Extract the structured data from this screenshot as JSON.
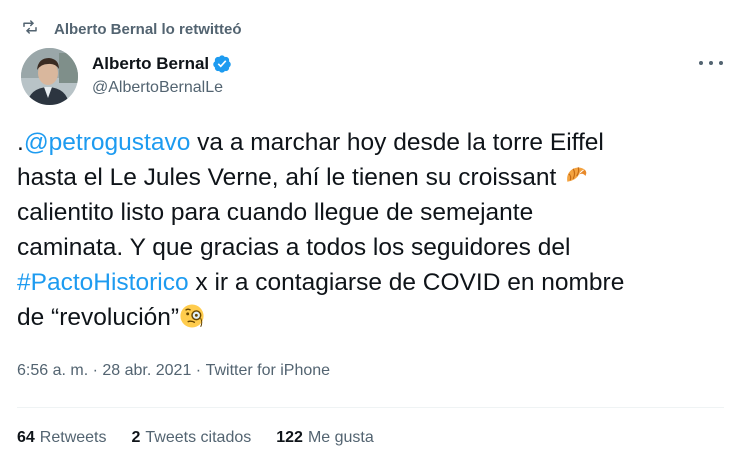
{
  "retweet": {
    "text": "Alberto Bernal lo retwitteó"
  },
  "author": {
    "name": "Alberto Bernal",
    "handle": "@AlbertoBernalLe"
  },
  "tweet": {
    "lines": [
      [
        {
          "t": "."
        },
        {
          "t": "@petrogustavo",
          "link": true
        },
        {
          "t": " va a marchar hoy desde la torre Eiffel"
        }
      ],
      [
        {
          "t": "hasta el Le Jules Verne, ahí le tienen su croissant "
        },
        {
          "emoji": "croissant"
        }
      ],
      [
        {
          "t": "calientito listo para cuando llegue de semejante"
        }
      ],
      [
        {
          "t": "caminata. Y que gracias a todos los seguidores del"
        }
      ],
      [
        {
          "t": "#PactoHistorico",
          "link": true
        },
        {
          "t": " x ir a contagiarse de COVID en nombre"
        }
      ],
      [
        {
          "t": "de “revolución”"
        },
        {
          "emoji": "monocle"
        }
      ]
    ]
  },
  "meta": {
    "time": "6:56 a. m.",
    "sep": " · ",
    "date": "28 abr. 2021",
    "source": "Twitter for iPhone"
  },
  "stats": {
    "retweets_count": "64",
    "retweets_label": "Retweets",
    "quotes_count": "2",
    "quotes_label": "Tweets citados",
    "likes_count": "122",
    "likes_label": "Me gusta"
  },
  "colors": {
    "link": "#1d9bf0",
    "secondary_text": "#536471",
    "primary_text": "#0f1419",
    "verified": "#1d9bf0"
  },
  "icons": [
    "retweet-icon",
    "verified-badge-icon",
    "more-icon",
    "croissant-emoji",
    "monocle-face-emoji"
  ]
}
